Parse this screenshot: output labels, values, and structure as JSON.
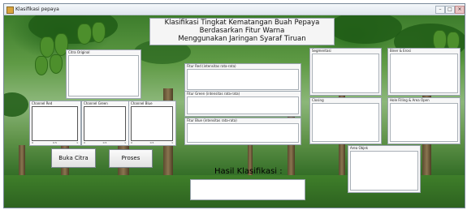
{
  "window": {
    "title": "Klasifikasi pepaya",
    "controls": [
      "–",
      "□",
      "×"
    ]
  },
  "header": {
    "title_lines": [
      "Klasifikasi Tingkat Kematangan Buah Pepaya",
      "Berdasarkan Fitur Warna",
      "Menggunakan Jaringan Syaraf Tiruan"
    ]
  },
  "panels": {
    "citra_original": "Citra Original",
    "channel_red": "Channel Red",
    "channel_green": "Channel Green",
    "channel_blue": "Channel Blue",
    "segmentasi": "Segmentasi",
    "biner_erosi": "Biner & Erosi",
    "closing": "Closing",
    "hole_filling": "Hole Filling & Area Open",
    "area_objek": "Area Objek"
  },
  "histogram_ticks": {
    "channel_red": [
      "0",
      "0.5",
      "1"
    ],
    "channel_green": [
      "0",
      "0.5",
      "1"
    ],
    "channel_blue": [
      "0",
      "0.5",
      "1"
    ]
  },
  "features": {
    "red": "Fitur Red (intensitas rata-rata)",
    "green": "Fitur Green (intensitas rata-rata)",
    "blue": "Fitur Blue (intensitas rata-rata)"
  },
  "buttons": {
    "load": "Buka Citra",
    "process": "Proses"
  },
  "result": {
    "label": "Hasil Klasifikasi :",
    "value": ""
  }
}
